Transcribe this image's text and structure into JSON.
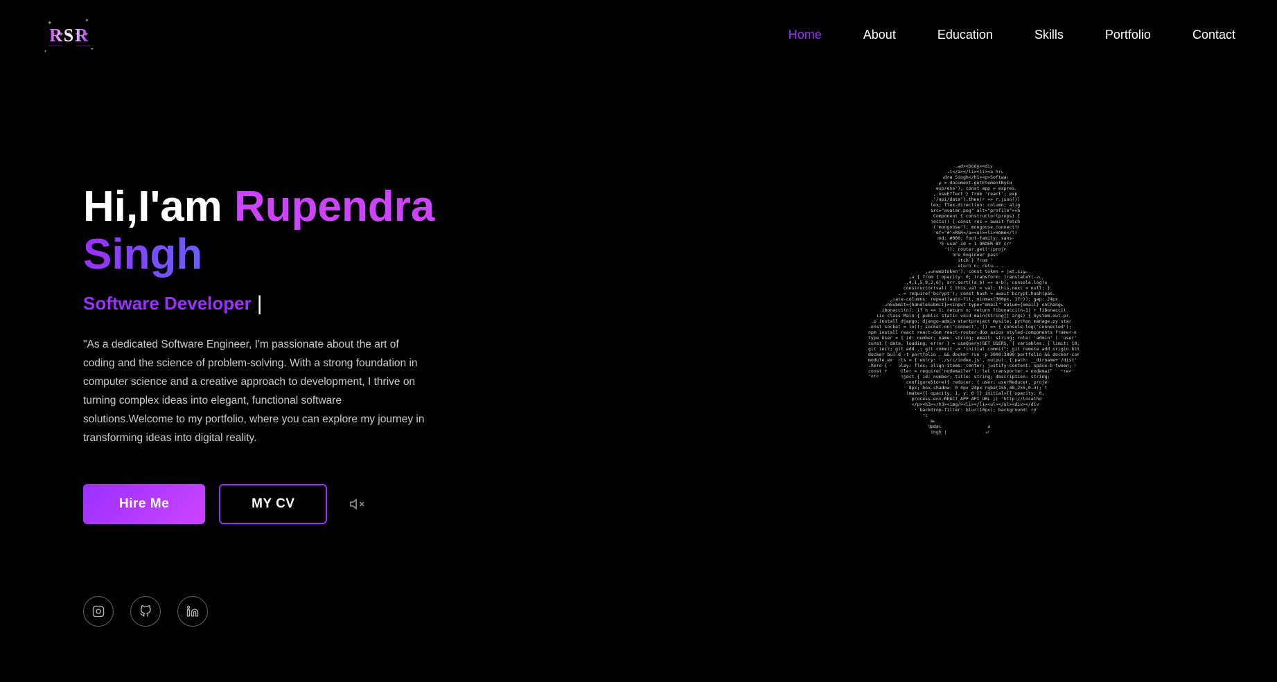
{
  "nav": {
    "logo_text": "RSR",
    "links": [
      {
        "label": "Home",
        "active": true,
        "id": "home"
      },
      {
        "label": "About",
        "active": false,
        "id": "about"
      },
      {
        "label": "Education",
        "active": false,
        "id": "education"
      },
      {
        "label": "Skills",
        "active": false,
        "id": "skills"
      },
      {
        "label": "Portfolio",
        "active": false,
        "id": "portfolio"
      },
      {
        "label": "Contact",
        "active": false,
        "id": "contact"
      }
    ]
  },
  "hero": {
    "greeting_start": "Hi,I'am ",
    "name_first": "Rupendra",
    "name_second": "Singh",
    "title": "Software Developer",
    "description": "\"As a dedicated Software Engineer, I'm passionate about the art of coding and the science of problem-solving. With a strong foundation in computer science and a creative approach to development, I thrive on turning complex ideas into elegant, functional software solutions.Welcome to my portfolio, where you can explore my journey in transforming ideas into digital reality.",
    "btn_hire": "Hire Me",
    "btn_cv": "MY CV"
  },
  "social": [
    {
      "label": "instagram",
      "icon": "instagram-icon"
    },
    {
      "label": "github",
      "icon": "github-icon"
    },
    {
      "label": "linkedin",
      "icon": "linkedin-icon"
    }
  ],
  "colors": {
    "bg": "#000000",
    "accent": "#9b30ff",
    "accent_light": "#cc44ff",
    "text_primary": "#ffffff",
    "text_secondary": "#cccccc",
    "gradient_start": "#9b30ff",
    "gradient_end": "#00bfff"
  }
}
